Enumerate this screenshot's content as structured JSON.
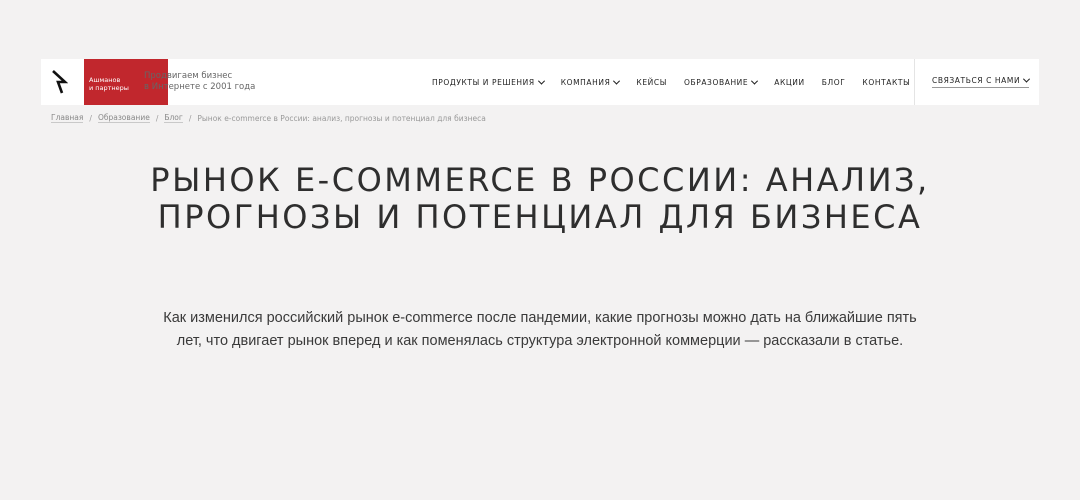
{
  "header": {
    "logo_text_line1": "Ашманов",
    "logo_text_line2": "и партнеры",
    "tagline_line1": "Продвигаем бизнес",
    "tagline_line2": "в Интернете с 2001 года",
    "brand_color": "#c1272d"
  },
  "nav": {
    "items": [
      {
        "label": "Продукты и решения",
        "has_dropdown": true
      },
      {
        "label": "Компания",
        "has_dropdown": true
      },
      {
        "label": "Кейсы",
        "has_dropdown": false
      },
      {
        "label": "Образование",
        "has_dropdown": true
      },
      {
        "label": "Акции",
        "has_dropdown": false
      },
      {
        "label": "Блог",
        "has_dropdown": false
      },
      {
        "label": "Контакты",
        "has_dropdown": false
      }
    ],
    "contact_label": "Связаться с нами"
  },
  "breadcrumb": {
    "items": [
      "Главная",
      "Образование",
      "Блог"
    ],
    "current": "Рынок e-commerce в России: анализ, прогнозы и потенциал для бизнеса"
  },
  "article": {
    "title": "Рынок e-commerce в России: анализ, прогнозы и потенциал для бизнеса",
    "lead": "Как изменился российский рынок e-commerce после пандемии, какие прогнозы можно дать на ближайшие пять лет, что двигает рынок вперед и как поменялась структура электронной коммерции — рассказали в статье."
  }
}
